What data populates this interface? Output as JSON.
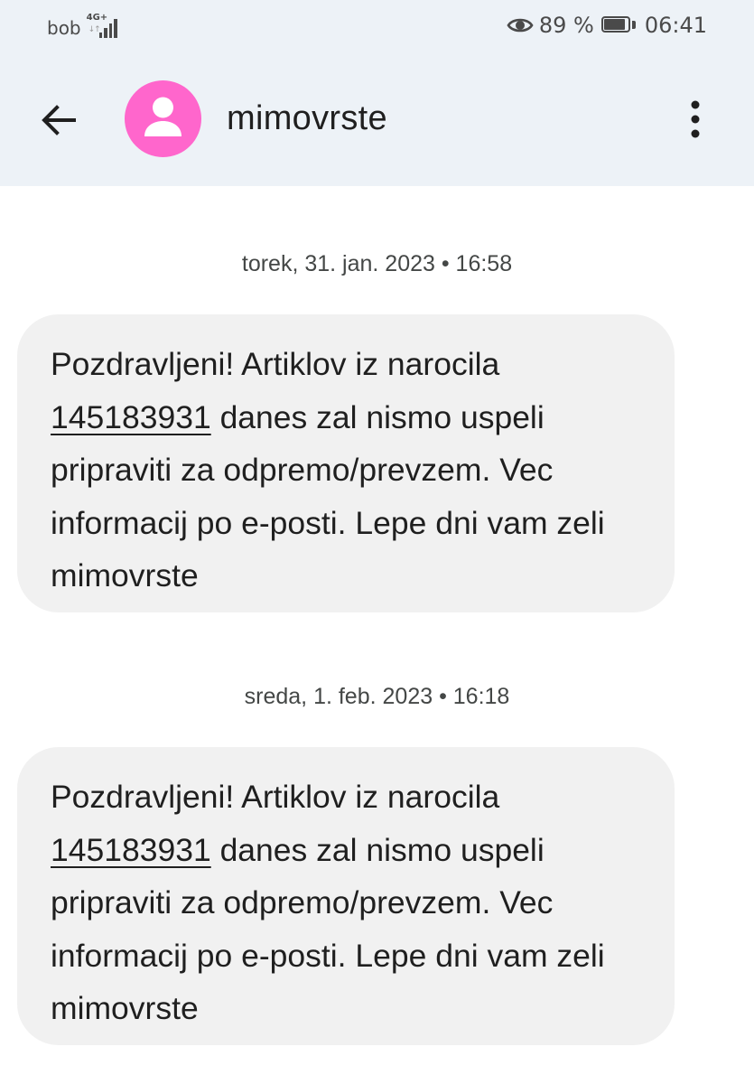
{
  "status_bar": {
    "carrier": "bob",
    "network_type": "4G+",
    "eye_icon": "eye-icon",
    "battery_percent": "89 %",
    "battery_level": 0.89,
    "time": "06:41"
  },
  "app_bar": {
    "back_icon": "arrow-back-icon",
    "avatar_icon": "person-avatar-icon",
    "avatar_color": "#ff66cc",
    "contact_name": "mimovrste",
    "more_icon": "more-vertical-icon"
  },
  "messages": [
    {
      "timestamp": "torek, 31. jan. 2023 • 16:58",
      "text_before_link": "Pozdravljeni! Artiklov iz narocila ",
      "link_text": "145183931",
      "text_after_link": " danes zal nismo uspeli pripraviti za odpremo/prevzem. Vec informacij po e-posti. Lepe dni vam zeli mimovrste"
    },
    {
      "timestamp": "sreda, 1. feb. 2023 • 16:18",
      "text_before_link": "Pozdravljeni! Artiklov iz narocila ",
      "link_text": "145183931",
      "text_after_link": " danes zal nismo uspeli pripraviti za odpremo/prevzem. Vec informacij po e-posti. Lepe dni vam zeli mimovrste"
    }
  ],
  "colors": {
    "header_bg": "#edf2f7",
    "bubble_bg": "#f1f1f1",
    "text": "#1f1f1f",
    "meta_text": "#444746"
  }
}
